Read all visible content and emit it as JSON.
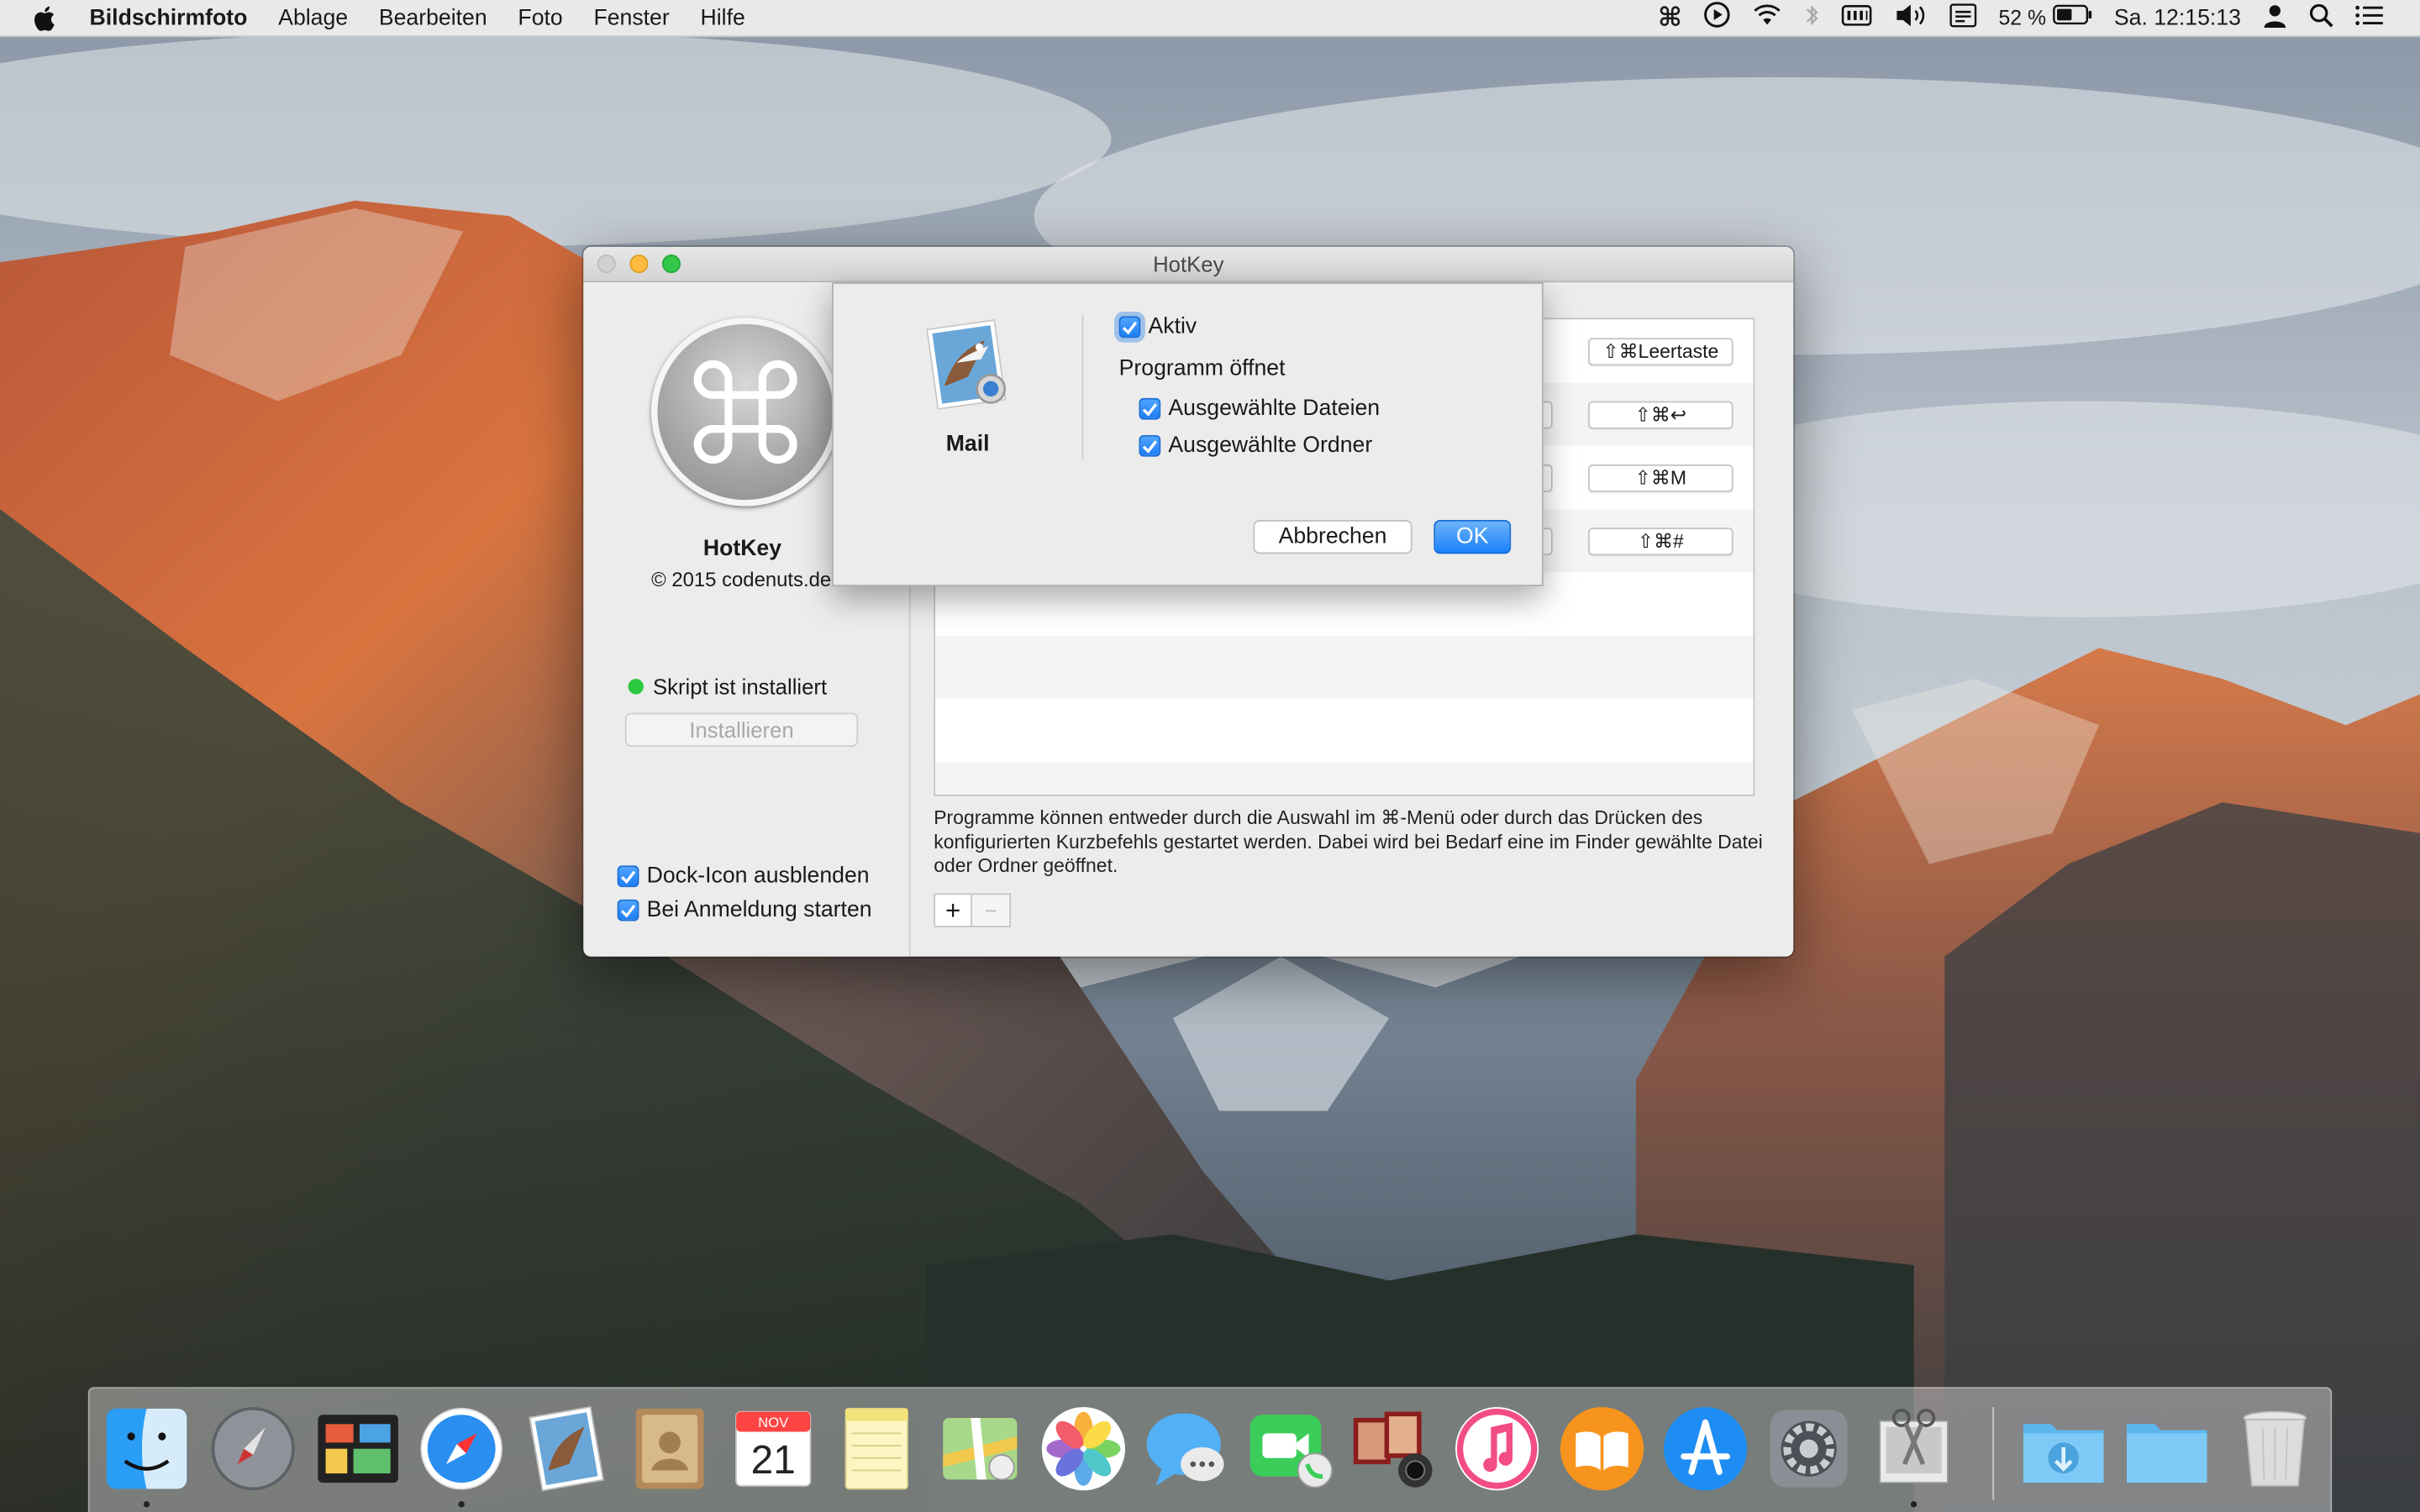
{
  "menubar": {
    "app_name": "Bildschirmfoto",
    "items": [
      "Ablage",
      "Bearbeiten",
      "Foto",
      "Fenster",
      "Hilfe"
    ],
    "battery": "52 %",
    "clock": "Sa. 12:15:13"
  },
  "window": {
    "title": "HotKey",
    "sidebar": {
      "app_name": "HotKey",
      "copyright": "© 2015 codenuts.de",
      "status": "Skript ist installiert",
      "install_button": "Installieren",
      "hide_dock_icon": "Dock-Icon ausblenden",
      "start_at_login": "Bei Anmeldung starten"
    },
    "shortcuts": [
      "⇧⌘Leertaste",
      "⇧⌘↩",
      "⇧⌘M",
      "⇧⌘#"
    ],
    "description": "Programme können entweder durch die Auswahl im ⌘-Menü oder durch das Drücken des konfigurierten Kurzbefehls gestartet werden. Dabei wird bei Bedarf eine im Finder gewählte Datei oder Ordner geöffnet.",
    "add_symbol": "+",
    "remove_symbol": "−"
  },
  "sheet": {
    "app_name": "Mail",
    "active_label": "Aktiv",
    "opens_label": "Programm öffnet",
    "selected_files": "Ausgewählte Dateien",
    "selected_folders": "Ausgewählte Ordner",
    "cancel": "Abbrechen",
    "ok": "OK"
  },
  "dock": {
    "items": [
      "finder-icon",
      "launchpad-icon",
      "mission-control-icon",
      "safari-icon",
      "mail-icon",
      "contacts-icon",
      "calendar-icon",
      "notes-icon",
      "maps-icon",
      "photos-icon",
      "messages-icon",
      "facetime-icon",
      "photo-booth-icon",
      "itunes-icon",
      "ibooks-icon",
      "app-store-icon",
      "system-preferences-icon",
      "screenshot-app-icon",
      "downloads-folder-icon",
      "documents-folder-icon",
      "trash-icon"
    ],
    "calendar_month": "NOV",
    "calendar_day": "21"
  },
  "colors": {
    "accent": "#1a82fb",
    "status_green": "#2bc93f"
  }
}
